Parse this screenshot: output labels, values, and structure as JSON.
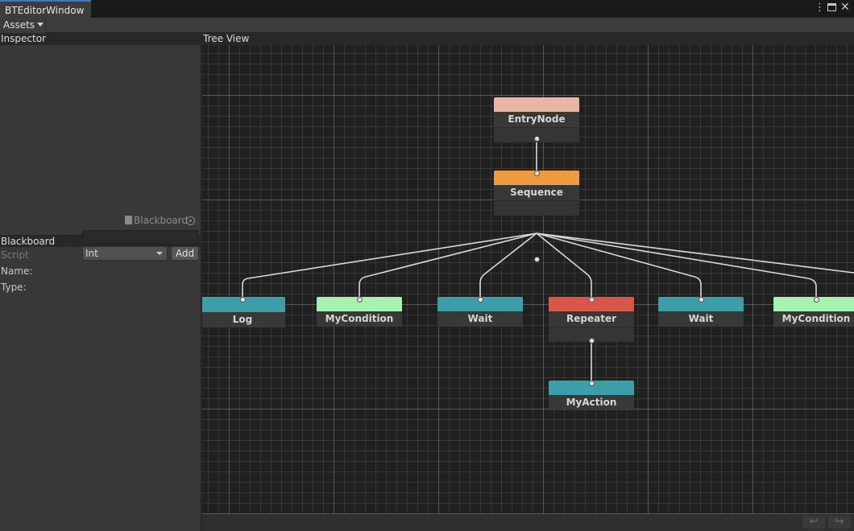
{
  "window": {
    "tab_title": "BTEditorWindow",
    "menu_icon": "kebab-menu-icon",
    "maximize_icon": "maximize-icon",
    "close_icon": "close-icon"
  },
  "toolbar": {
    "assets_label": "Assets"
  },
  "inspector": {
    "header": "Inspector"
  },
  "blackboard": {
    "header": "Blackboard",
    "script_label": "Script",
    "script_value": "Blackboard",
    "name_label": "Name:",
    "name_value": "",
    "type_label": "Type:",
    "type_value": "Int",
    "add_label": "Add"
  },
  "tree_view": {
    "header": "Tree View",
    "nodes": [
      {
        "id": "entry",
        "title": "EntryNode",
        "color": "#e8b6a6"
      },
      {
        "id": "sequence",
        "title": "Sequence",
        "color": "#ee9a3e"
      },
      {
        "id": "log",
        "title": "Log",
        "color": "#3b9ea9"
      },
      {
        "id": "cond1",
        "title": "MyCondition",
        "color": "#a8f0b0"
      },
      {
        "id": "wait1",
        "title": "Wait",
        "color": "#3b9ea9"
      },
      {
        "id": "repeater",
        "title": "Repeater",
        "color": "#d9574a"
      },
      {
        "id": "wait2",
        "title": "Wait",
        "color": "#3b9ea9"
      },
      {
        "id": "cond2",
        "title": "MyCondition",
        "color": "#a8f0b0"
      },
      {
        "id": "action",
        "title": "MyAction",
        "color": "#3b9ea9"
      }
    ]
  },
  "footer": {
    "undo_icon": "undo-icon",
    "redo_icon": "redo-icon"
  }
}
